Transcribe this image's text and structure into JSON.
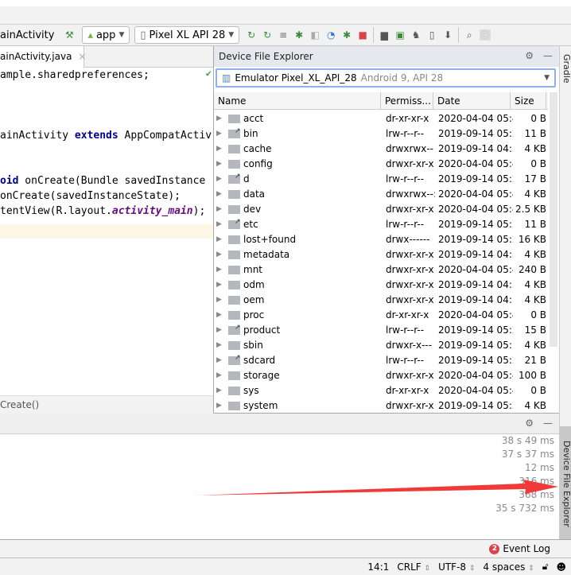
{
  "toolbar": {
    "config": "ainActivity",
    "module": "app",
    "device": "Pixel XL API 28"
  },
  "editor": {
    "tab": "ainActivity.java",
    "lines": [
      {
        "row": 0,
        "parts": [
          {
            "t": "ample.sharedpreferences;",
            "c": ""
          }
        ]
      },
      {
        "row": 4,
        "parts": [
          {
            "t": "ainActivity ",
            "c": ""
          },
          {
            "t": "extends",
            "c": "kw"
          },
          {
            "t": " AppCompatActiv",
            "c": ""
          }
        ]
      },
      {
        "row": 7,
        "parts": [
          {
            "t": "oid",
            "c": "kw"
          },
          {
            "t": " onCreate(Bundle savedInstance",
            "c": ""
          }
        ]
      },
      {
        "row": 8,
        "parts": [
          {
            "t": "onCreate(savedInstanceState);",
            "c": ""
          }
        ]
      },
      {
        "row": 9,
        "parts": [
          {
            "t": "tentView(R.layout.",
            "c": ""
          },
          {
            "t": "activity_main",
            "c": "it"
          },
          {
            "t": ");",
            "c": ""
          }
        ]
      }
    ],
    "breadcrumb": "Create()"
  },
  "explorer": {
    "title": "Device File Explorer",
    "device": "Emulator Pixel_XL_API_28",
    "device_detail": "Android 9, API 28",
    "columns": [
      "Name",
      "Permiss...",
      "Date",
      "Size"
    ],
    "files": [
      {
        "name": "acct",
        "perm": "dr-xr-xr-x",
        "date": "2020-04-04 05:4",
        "size": "0 B",
        "link": false
      },
      {
        "name": "bin",
        "perm": "lrw-r--r--",
        "date": "2019-09-14 05:2",
        "size": "11 B",
        "link": true
      },
      {
        "name": "cache",
        "perm": "drwxrwx--",
        "date": "2019-09-14 04:5",
        "size": "4 KB",
        "link": false
      },
      {
        "name": "config",
        "perm": "drwxr-xr-x",
        "date": "2020-04-04 05:4",
        "size": "0 B",
        "link": false
      },
      {
        "name": "d",
        "perm": "lrw-r--r--",
        "date": "2019-09-14 05:2",
        "size": "17 B",
        "link": true
      },
      {
        "name": "data",
        "perm": "drwxrwx--:",
        "date": "2020-04-04 05:4",
        "size": "4 KB",
        "link": false
      },
      {
        "name": "dev",
        "perm": "drwxr-xr-x",
        "date": "2020-04-04 05:4",
        "size": "2.5 KB",
        "link": false
      },
      {
        "name": "etc",
        "perm": "lrw-r--r--",
        "date": "2019-09-14 05:2",
        "size": "11 B",
        "link": true
      },
      {
        "name": "lost+found",
        "perm": "drwx------",
        "date": "2019-09-14 05:2",
        "size": "16 KB",
        "link": false
      },
      {
        "name": "metadata",
        "perm": "drwxr-xr-x",
        "date": "2019-09-14 04:5",
        "size": "4 KB",
        "link": false
      },
      {
        "name": "mnt",
        "perm": "drwxr-xr-x",
        "date": "2020-04-04 05:4",
        "size": "240 B",
        "link": false
      },
      {
        "name": "odm",
        "perm": "drwxr-xr-x",
        "date": "2019-09-14 04:5",
        "size": "4 KB",
        "link": false
      },
      {
        "name": "oem",
        "perm": "drwxr-xr-x",
        "date": "2019-09-14 04:5",
        "size": "4 KB",
        "link": false
      },
      {
        "name": "proc",
        "perm": "dr-xr-xr-x",
        "date": "2020-04-04 05:4",
        "size": "0 B",
        "link": false
      },
      {
        "name": "product",
        "perm": "lrw-r--r--",
        "date": "2019-09-14 05:2",
        "size": "15 B",
        "link": true
      },
      {
        "name": "sbin",
        "perm": "drwxr-x---",
        "date": "2019-09-14 05:1",
        "size": "4 KB",
        "link": false
      },
      {
        "name": "sdcard",
        "perm": "lrw-r--r--",
        "date": "2019-09-14 05:2",
        "size": "21 B",
        "link": true
      },
      {
        "name": "storage",
        "perm": "drwxr-xr-x",
        "date": "2020-04-04 05:4",
        "size": "100 B",
        "link": false
      },
      {
        "name": "sys",
        "perm": "dr-xr-xr-x",
        "date": "2020-04-04 05:4",
        "size": "0 B",
        "link": false
      },
      {
        "name": "system",
        "perm": "drwxr-xr-x",
        "date": "2019-09-14 05:2",
        "size": "4 KB",
        "link": false
      }
    ]
  },
  "side": {
    "gradle": "Gradle",
    "dfe": "Device File Explorer"
  },
  "bottom": {
    "times": [
      "38 s 49 ms",
      "37 s 37 ms",
      "12 ms",
      "316 ms",
      "368 ms",
      "35 s 732 ms"
    ]
  },
  "eventlog": {
    "count": "2",
    "label": "Event Log"
  },
  "status": {
    "position": "14:1",
    "line_sep": "CRLF",
    "encoding": "UTF-8",
    "indent": "4 spaces"
  },
  "colors": {
    "arrow": "#f03a3a",
    "accent": "#8fb0e8"
  }
}
